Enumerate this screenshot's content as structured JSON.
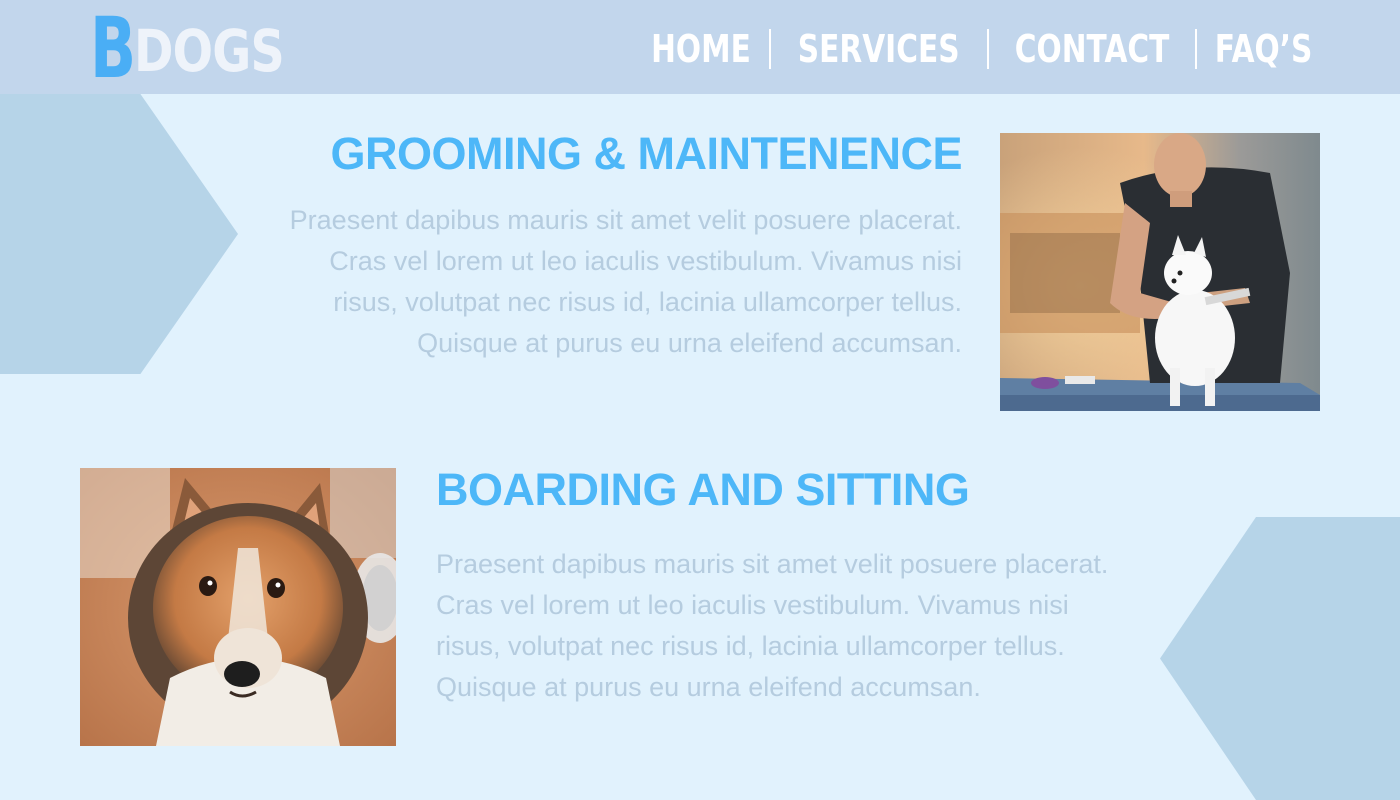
{
  "header": {
    "logo": {
      "initial": "B",
      "rest": "DOGS"
    },
    "nav": [
      {
        "label": "HOME"
      },
      {
        "label": "SERVICES"
      },
      {
        "label": "CONTACT"
      },
      {
        "label": "FAQ’S"
      }
    ]
  },
  "sections": [
    {
      "title": "GROOMING & MAINTENENCE",
      "body": "Praesent dapibus mauris sit amet velit posuere placerat. Cras vel lorem ut leo iaculis vestibulum. Vivamus nisi risus, volutpat nec risus id, lacinia ullamcorper tellus. Quisque at purus eu urna eleifend accumsan."
    },
    {
      "title": "BOARDING AND SITTING",
      "body": "Praesent dapibus mauris sit amet velit posuere placerat. Cras vel lorem ut leo iaculis vestibulum. Vivamus nisi risus, volutpat nec risus id, lacinia ullamcorper tellus. Quisque at purus eu urna eleifend accumsan."
    }
  ],
  "colors": {
    "page_bg": "#e1f2fd",
    "header_bg": "#c2d6ec",
    "accent": "#4db7f8",
    "body_text": "#b5ccdf",
    "decor": "#b6d4e8"
  }
}
